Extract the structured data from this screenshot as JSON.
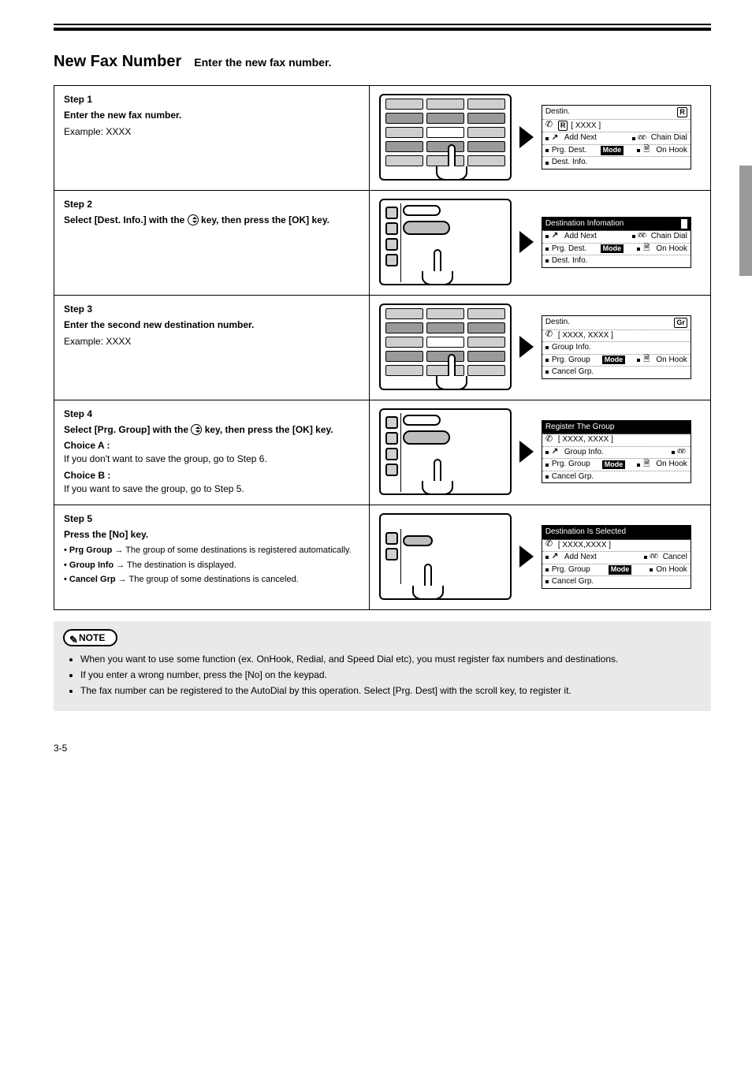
{
  "header": {
    "h1": "New Fax Number",
    "h2": "Enter the new fax number."
  },
  "steps": [
    {
      "left": {
        "label": "Step 1",
        "title": "Enter the new fax number.",
        "body": "Example: XXXX"
      },
      "lcd": {
        "title_left": "Destin.",
        "badge": "R",
        "black": false,
        "rows": [
          {
            "type": "phoneR",
            "text": "[  XXXX           ]"
          },
          {
            "type": "split",
            "l_icon": "bounce",
            "l": "Add Next",
            "r_icon": "2phone",
            "r": "Chain Dial"
          },
          {
            "type": "split",
            "l_icon": "dot",
            "l": "Prg. Dest.",
            "mid_chip": "Mode",
            "r_icon": "doc",
            "r": "On Hook"
          },
          {
            "type": "plain",
            "l_icon": "dot",
            "l": "Dest. Info."
          }
        ]
      },
      "illus": "keypad"
    },
    {
      "left": {
        "label": "Step 2",
        "title_prefix": "Select [Dest. Info.] with the ",
        "title_suffix": " key, then press the [OK] key.",
        "body": "",
        "choice_a": "",
        "choice_b": ""
      },
      "lcd": {
        "title_left": "Destination Infomation",
        "black": true,
        "sel_col": 1,
        "rows": [
          {
            "type": "split",
            "l_icon": "bounce",
            "l": "Add Next",
            "r_icon": "2phone",
            "r": "Chain Dial"
          },
          {
            "type": "split",
            "l_icon": "dot",
            "l": "Prg. Dest.",
            "mid_chip": "Mode",
            "r_icon": "doc",
            "r": "On Hook"
          },
          {
            "type": "plain",
            "l_icon": "dot",
            "l": "Dest. Info."
          }
        ]
      },
      "illus": "panel-ok"
    },
    {
      "left": {
        "label": "Step 3",
        "title": "Enter the second new destination number.",
        "body": "Example: XXXX"
      },
      "lcd": {
        "title_left": "Destin.",
        "badge": "Gr",
        "black": false,
        "rows": [
          {
            "type": "phone",
            "text": "[  XXXX, XXXX   ]"
          },
          {
            "type": "plain",
            "l_icon": "dot",
            "l": "Group Info."
          },
          {
            "type": "split",
            "l_icon": "dot",
            "l": "Prg. Group",
            "mid_chip": "Mode",
            "r_icon": "doc",
            "r": "On Hook"
          },
          {
            "type": "plain",
            "l_icon": "dot",
            "l": "Cancel Grp."
          }
        ]
      },
      "illus": "keypad"
    },
    {
      "left": {
        "label": "Step 4",
        "title_pre": "Select [Prg. Group] with the ",
        "title_suf": " key, then press the [OK] key.",
        "choice_a_label": "Choice A :",
        "choice_a": "If you don't want to save the group, go to Step 6.",
        "choice_b_label": "Choice B :",
        "choice_b": "If you want to save the group, go to Step 5."
      },
      "lcd": {
        "title_left": "Register The Group",
        "black": true,
        "rows": [
          {
            "type": "phone",
            "text": "[  XXXX, XXXX   ]"
          },
          {
            "type": "split",
            "l_icon": "bounce",
            "l": "Group Info.",
            "r_icon": "2phone",
            "r": ""
          },
          {
            "type": "split",
            "l_icon": "dot",
            "l": "Prg. Group",
            "mid_chip": "Mode",
            "r_icon": "doc",
            "r": "On Hook"
          },
          {
            "type": "plain",
            "l_icon": "dot",
            "l": "Cancel Grp."
          }
        ]
      },
      "illus": "panel-ok"
    },
    {
      "left": {
        "label": "Step 5",
        "title": "Press the [No] key.",
        "sub1_strong": "• Prg Group ",
        "sub1": "→ The group of some destinations is registered automatically.",
        "sub2_strong": "• Group Info ",
        "sub2": "→ The destination is displayed.",
        "sub3_strong": "• Cancel Grp ",
        "sub3": "→ The group of some destinations is canceled."
      },
      "lcd": {
        "title_left": "Destination Is Selected",
        "black": true,
        "rows": [
          {
            "type": "phone",
            "text": "[  XXXX,XXXX      ]"
          },
          {
            "type": "split",
            "l_icon": "bounce",
            "l": "Add Next",
            "r_icon": "2phone",
            "r": "Cancel"
          },
          {
            "type": "split",
            "l_icon": "dot",
            "l": "Prg. Group",
            "mid_chip": "Mode",
            "r_icon": "dot",
            "r": "On Hook"
          },
          {
            "type": "plain",
            "l_icon": "dot",
            "l": "Cancel Grp."
          }
        ]
      },
      "illus": "panel-no"
    }
  ],
  "note": {
    "label": "NOTE",
    "items": [
      "When you want to use some function (ex. OnHook, Redial, and Speed Dial etc), you must register fax numbers and destinations.",
      "If you enter a wrong number, press the [No] on the keypad.",
      "The fax number can be registered to the AutoDial by this operation. Select [Prg. Dest] with the scroll key, to register it."
    ]
  },
  "footer": {
    "page": "3-5"
  }
}
